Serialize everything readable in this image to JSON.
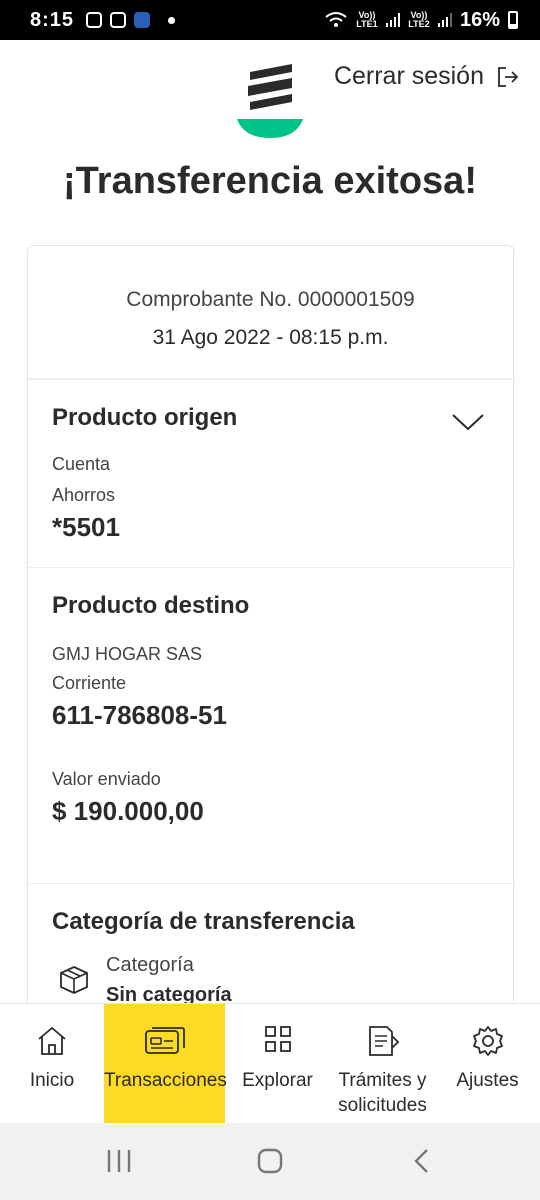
{
  "status_bar": {
    "time": "8:15",
    "network_1": "Vo)) LTE1",
    "network_2": "Vo)) LTE2",
    "battery": "16%"
  },
  "header": {
    "logout_label": "Cerrar sesión",
    "brand_colors": {
      "logo": "#2b2b2b",
      "accent": "#00c389"
    }
  },
  "title": "¡Transferencia exitosa!",
  "receipt": {
    "number": "Comprobante No. 0000001509",
    "datetime": "31 Ago 2022 - 08:15 p.m."
  },
  "origin": {
    "heading": "Producto origen",
    "account_type_1": "Cuenta",
    "account_type_2": "Ahorros",
    "account_number": "*5501"
  },
  "destination": {
    "heading": "Producto destino",
    "holder": "GMJ HOGAR SAS",
    "account_type": "Corriente",
    "account_number": "611-786808-51",
    "amount_label": "Valor enviado",
    "amount": "$ 190.000,00"
  },
  "category": {
    "heading": "Categoría de transferencia",
    "label": "Categoría",
    "value": "Sin categoría"
  },
  "nav": {
    "items": [
      {
        "label": "Inicio",
        "icon": "home-icon"
      },
      {
        "label": "Transacciones",
        "icon": "card-icon"
      },
      {
        "label": "Explorar",
        "icon": "grid-icon"
      },
      {
        "label_1": "Trámites y",
        "label_2": "solicitudes",
        "icon": "document-icon"
      },
      {
        "label": "Ajustes",
        "icon": "gear-icon"
      }
    ],
    "active_color": "#fdda24"
  }
}
